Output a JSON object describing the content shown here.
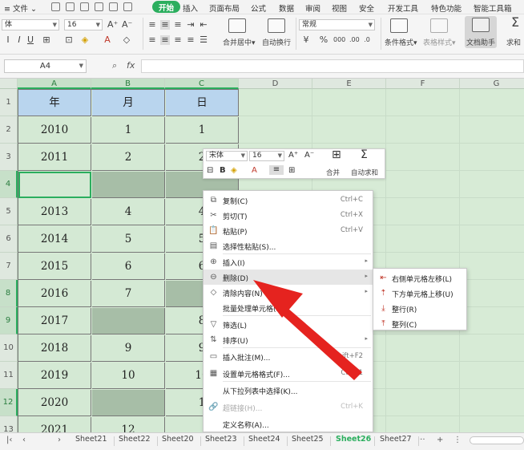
{
  "menubar": {
    "file": "文件",
    "tabs": [
      "开始",
      "插入",
      "页面布局",
      "公式",
      "数据",
      "审阅",
      "视图",
      "安全",
      "开发工具",
      "特色功能",
      "智能工具箱"
    ],
    "active_tab": "开始"
  },
  "ribbon": {
    "font_name": "体",
    "font_size": "16",
    "merge_center": "合并居中",
    "auto_wrap": "自动换行",
    "number_format": "常规",
    "conditional_format": "条件格式",
    "table_style": "表格样式",
    "doc_helper": "文档助手",
    "sum": "求和"
  },
  "formula_bar": {
    "cell_ref": "A4",
    "fx_label": "fx",
    "content": ""
  },
  "grid": {
    "columns": [
      "A",
      "B",
      "C",
      "D",
      "E",
      "F",
      "G"
    ],
    "rows": [
      "1",
      "2",
      "3",
      "4",
      "5",
      "6",
      "7",
      "8",
      "9",
      "10",
      "11",
      "12",
      "13"
    ],
    "table": {
      "header": [
        "年",
        "月",
        "日"
      ],
      "rows": [
        [
          "2010",
          "1",
          "1"
        ],
        [
          "2011",
          "2",
          "2"
        ],
        [
          "",
          "",
          ""
        ],
        [
          "2013",
          "4",
          "4"
        ],
        [
          "2014",
          "5",
          "5"
        ],
        [
          "2015",
          "6",
          "6"
        ],
        [
          "2016",
          "7",
          ""
        ],
        [
          "2017",
          "",
          "8"
        ],
        [
          "2018",
          "9",
          "9"
        ],
        [
          "2019",
          "10",
          "10"
        ],
        [
          "2020",
          "",
          "1"
        ],
        [
          "2021",
          "12",
          ""
        ]
      ]
    },
    "colors": {
      "header_fill": "#b9d5ee",
      "data_fill": "#d4e9d4",
      "selected_fill": "#a7bea7",
      "sheet_bg": "#d7ebd6",
      "accent": "#2bae5e"
    }
  },
  "mini_toolbar": {
    "font_name": "宋体",
    "font_size": "16",
    "bold": "B",
    "merge": "合并",
    "autosum": "自动求和"
  },
  "context_menu": {
    "items": [
      {
        "label": "复制(C)",
        "shortcut": "Ctrl+C",
        "icon": "copy-icon"
      },
      {
        "label": "剪切(T)",
        "shortcut": "Ctrl+X",
        "icon": "scissors-icon"
      },
      {
        "label": "粘贴(P)",
        "shortcut": "Ctrl+V",
        "icon": "paste-icon"
      },
      {
        "label": "选择性粘贴(S)...",
        "shortcut": "",
        "icon": "paste-special-icon"
      },
      {
        "label": "插入(I)",
        "shortcut": "",
        "icon": "insert-icon"
      },
      {
        "label": "删除(D)",
        "shortcut": "",
        "icon": "delete-icon"
      },
      {
        "label": "清除内容(N)",
        "shortcut": "",
        "icon": "eraser-icon"
      },
      {
        "label": "批量处理单元格(P)",
        "shortcut": "",
        "icon": ""
      },
      {
        "label": "筛选(L)",
        "shortcut": "",
        "icon": "filter-icon"
      },
      {
        "label": "排序(U)",
        "shortcut": "",
        "icon": "sort-icon"
      },
      {
        "label": "插入批注(M)...",
        "shortcut": "Shift+F2",
        "icon": "comment-icon"
      },
      {
        "label": "设置单元格格式(F)...",
        "shortcut": "Ctrl+1",
        "icon": "format-cells-icon"
      },
      {
        "label": "从下拉列表中选择(K)...",
        "shortcut": "",
        "icon": ""
      },
      {
        "label": "超链接(H)...",
        "shortcut": "Ctrl+K",
        "icon": "link-icon"
      },
      {
        "label": "定义名称(A)...",
        "shortcut": "",
        "icon": ""
      }
    ]
  },
  "delete_submenu": {
    "items": [
      {
        "label": "右侧单元格左移(L)",
        "icon": "shift-left-icon"
      },
      {
        "label": "下方单元格上移(U)",
        "icon": "shift-up-icon"
      },
      {
        "label": "整行(R)",
        "icon": "entire-row-icon"
      },
      {
        "label": "整列(C)",
        "icon": "entire-column-icon"
      }
    ]
  },
  "sheet_tabs": {
    "tabs": [
      "Sheet21",
      "Sheet22",
      "Sheet20",
      "Sheet23",
      "Sheet24",
      "Sheet25",
      "Sheet26",
      "Sheet27"
    ],
    "active": "Sheet26",
    "more": "···",
    "add": "+"
  }
}
